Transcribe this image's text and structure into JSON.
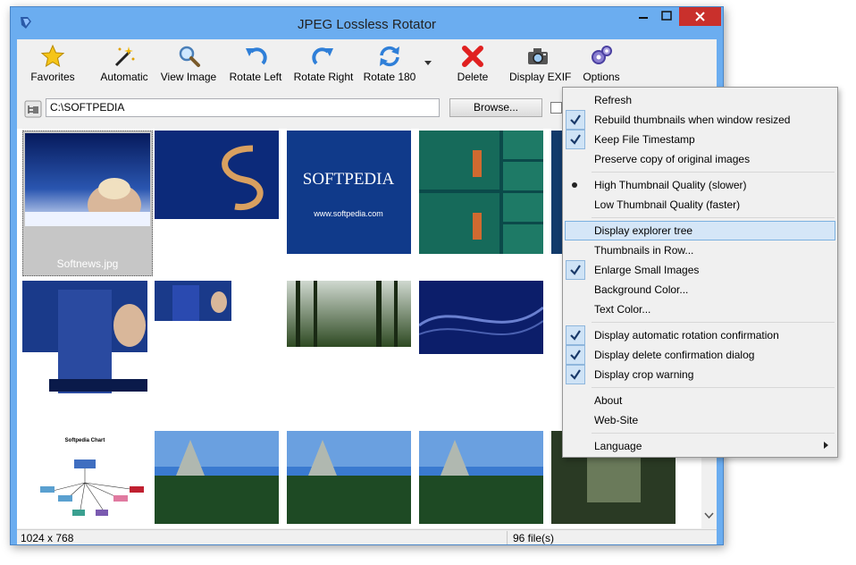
{
  "window": {
    "title": "JPEG Lossless Rotator"
  },
  "toolbar": {
    "items": [
      {
        "label": "Favorites",
        "icon": "star-icon"
      },
      {
        "label": "Automatic",
        "icon": "magic-wand-icon"
      },
      {
        "label": "View Image",
        "icon": "magnifier-icon"
      },
      {
        "label": "Rotate Left",
        "icon": "rotate-left-icon"
      },
      {
        "label": "Rotate Right",
        "icon": "rotate-right-icon"
      },
      {
        "label": "Rotate 180",
        "icon": "rotate-180-icon"
      },
      {
        "label": "Delete",
        "icon": "delete-x-icon"
      },
      {
        "label": "Display EXIF",
        "icon": "camera-icon"
      },
      {
        "label": "Options",
        "icon": "gears-icon"
      }
    ]
  },
  "pathbar": {
    "path": "C:\\SOFTPEDIA",
    "browse_label": "Browse..."
  },
  "thumbnails": {
    "selected_filename": "Softnews.jpg",
    "image_texts": {
      "softpedia_logo": "SOFTPEDIA",
      "softpedia_url": "www.softpedia.com",
      "chart_title": "Softpedia Chart"
    }
  },
  "status": {
    "dimensions": "1024 x 768",
    "file_count": "96 file(s)"
  },
  "menu": {
    "items": [
      {
        "label": "Refresh",
        "state": "none"
      },
      {
        "label": "Rebuild thumbnails when window resized",
        "state": "checked"
      },
      {
        "label": "Keep File Timestamp",
        "state": "checked"
      },
      {
        "label": "Preserve copy of original images",
        "state": "none"
      },
      {
        "label": "High Thumbnail Quality (slower)",
        "state": "radio"
      },
      {
        "label": "Low Thumbnail Quality (faster)",
        "state": "none"
      },
      {
        "label": "Display explorer tree",
        "state": "highlighted"
      },
      {
        "label": "Thumbnails in Row...",
        "state": "none"
      },
      {
        "label": "Enlarge Small Images",
        "state": "checked"
      },
      {
        "label": "Background Color...",
        "state": "none"
      },
      {
        "label": "Text Color...",
        "state": "none"
      },
      {
        "label": "Display automatic rotation confirmation",
        "state": "checked"
      },
      {
        "label": "Display delete confirmation dialog",
        "state": "checked"
      },
      {
        "label": "Display crop warning",
        "state": "checked"
      },
      {
        "label": "About",
        "state": "none"
      },
      {
        "label": "Web-Site",
        "state": "none"
      },
      {
        "label": "Language",
        "state": "submenu"
      }
    ]
  },
  "colors": {
    "title_bar": "#6badf0",
    "close_button": "#c9302c",
    "menu_highlight": "#d5e6f7",
    "check_background": "#cfe3f6"
  }
}
